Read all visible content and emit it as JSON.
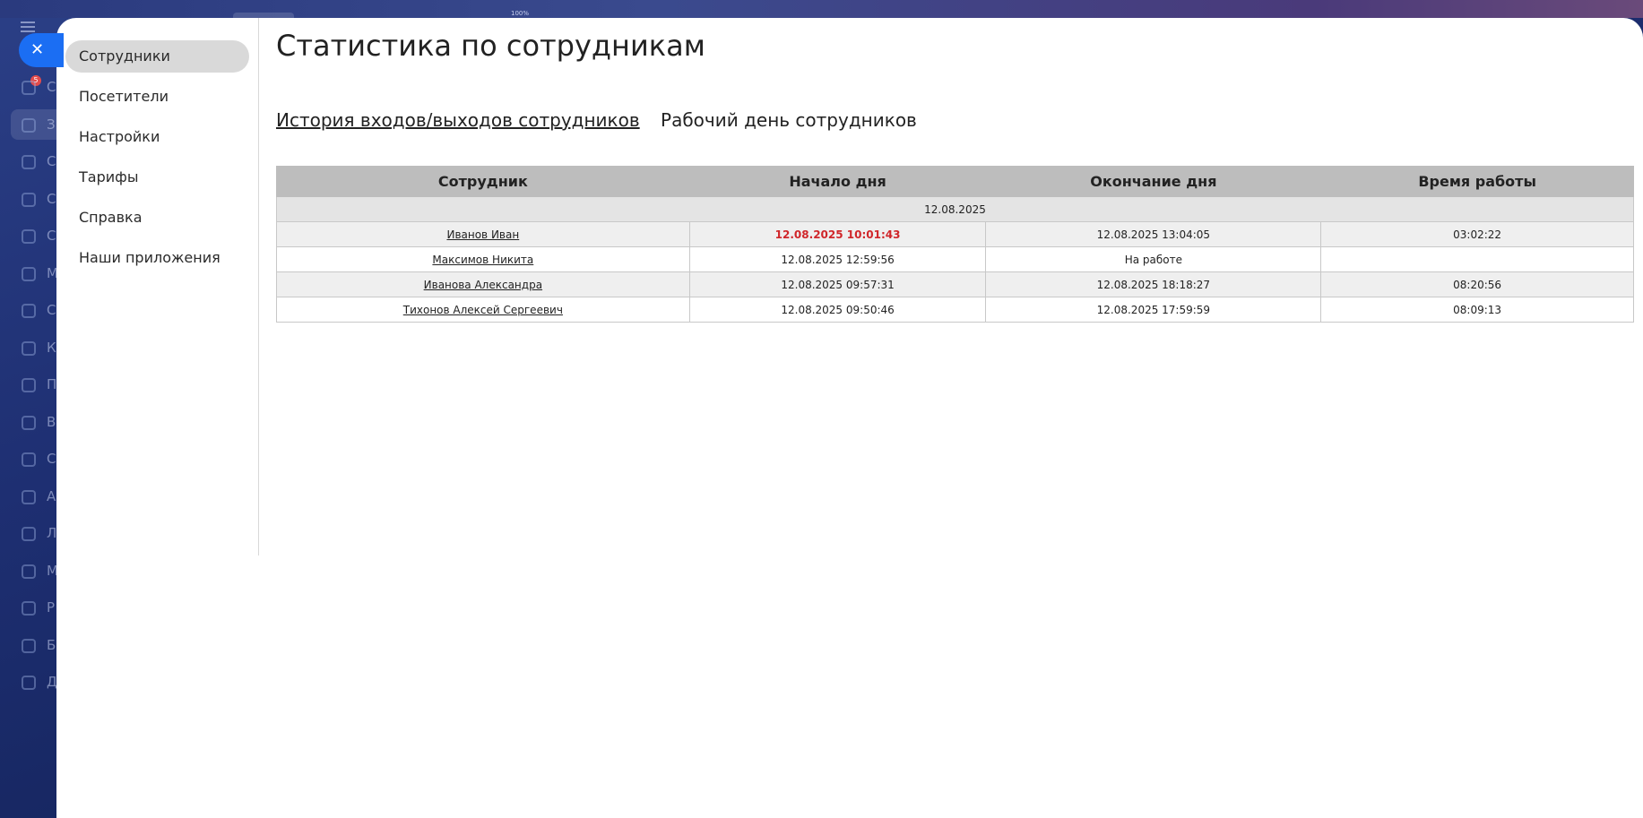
{
  "background": {
    "zoom_label": "100%",
    "nav_letters": [
      "С",
      "З",
      "С",
      "С",
      "С",
      "М",
      "С",
      "К",
      "П",
      "В",
      "С",
      "А",
      "Л",
      "М",
      "Р",
      "Б",
      "Д"
    ],
    "badge_count": "5"
  },
  "close_button": {
    "label": "✕"
  },
  "sidebar": {
    "items": [
      {
        "label": "Сотрудники",
        "active": true
      },
      {
        "label": "Посетители",
        "active": false
      },
      {
        "label": "Настройки",
        "active": false
      },
      {
        "label": "Тарифы",
        "active": false
      },
      {
        "label": "Справка",
        "active": false
      },
      {
        "label": "Наши приложения",
        "active": false
      }
    ]
  },
  "page": {
    "title": "Статистика по сотрудникам",
    "tabs": [
      {
        "label": "История входов/выходов сотрудников",
        "active": true
      },
      {
        "label": "Рабочий день сотрудников",
        "active": false
      }
    ]
  },
  "table": {
    "headers": [
      "Сотрудник",
      "Начало дня",
      "Окончание дня",
      "Время работы"
    ],
    "date": "12.08.2025",
    "rows": [
      {
        "employee": "Иванов Иван",
        "start": "12.08.2025 10:01:43",
        "end": "12.08.2025 13:04:05",
        "duration": "03:02:22",
        "late": true
      },
      {
        "employee": "Максимов Никита",
        "start": "12.08.2025 12:59:56",
        "end": "На работе",
        "duration": "",
        "late": false
      },
      {
        "employee": "Иванова Александра",
        "start": "12.08.2025 09:57:31",
        "end": "12.08.2025 18:18:27",
        "duration": "08:20:56",
        "late": false
      },
      {
        "employee": "Тихонов Алексей Сергеевич",
        "start": "12.08.2025 09:50:46",
        "end": "12.08.2025 17:59:59",
        "duration": "08:09:13",
        "late": false
      }
    ]
  },
  "colors": {
    "accent": "#1b6ef3",
    "late_text": "#d0262a",
    "header_bg": "#bdbdbd",
    "active_sidebar_bg": "#d9d9d9"
  }
}
